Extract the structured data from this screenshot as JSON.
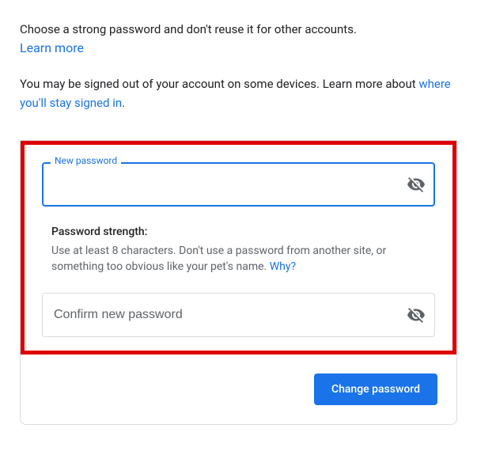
{
  "intro": {
    "text": "Choose a strong password and don't reuse it for other accounts.",
    "learn_more": "Learn more"
  },
  "signed_out": {
    "prefix": "You may be signed out of your account on some devices. Learn more about ",
    "link": "where you'll stay signed in",
    "suffix": "."
  },
  "new_password": {
    "label": "New password",
    "value": ""
  },
  "strength": {
    "title": "Password strength:",
    "desc": "Use at least 8 characters. Don't use a password from another site, or something too obvious like your pet's name. ",
    "why": "Why?"
  },
  "confirm_password": {
    "placeholder": "Confirm new password",
    "value": ""
  },
  "button": {
    "change_password": "Change password"
  }
}
